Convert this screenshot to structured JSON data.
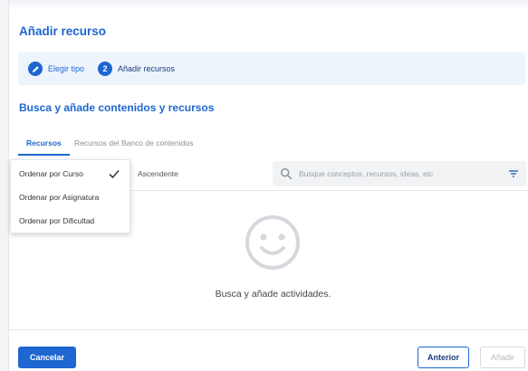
{
  "dialog": {
    "title": "Añadir recurso"
  },
  "stepper": {
    "steps": [
      {
        "marker": "",
        "label": "Elegir tipo"
      },
      {
        "marker": "2",
        "label": "Añadir recursos"
      }
    ]
  },
  "section": {
    "title": "Busca y añade contenidos y recursos"
  },
  "tabs": [
    {
      "label": "Recursos",
      "active": true
    },
    {
      "label": "Recursos del Banco de contenidos",
      "active": false
    }
  ],
  "toolbar": {
    "order_direction": "Ascendente",
    "search_placeholder": "Busque conceptos, recursos, ideas, etc"
  },
  "sort_menu": {
    "options": [
      {
        "label": "Ordenar por Curso",
        "selected": true
      },
      {
        "label": "Ordenar por Asignatura",
        "selected": false
      },
      {
        "label": "Ordenar por Dificultad",
        "selected": false
      }
    ]
  },
  "empty_state": {
    "icon": "smiley-face-icon",
    "message": "Busca y añade actividades."
  },
  "footer": {
    "cancel_label": "Cancelar",
    "previous_label": "Anterior",
    "add_label": "Añadir"
  },
  "colors": {
    "accent": "#1e66d0",
    "stepper_bg": "#eef4fc",
    "search_bg": "#f1f3f5",
    "disabled": "#b5bac0"
  }
}
